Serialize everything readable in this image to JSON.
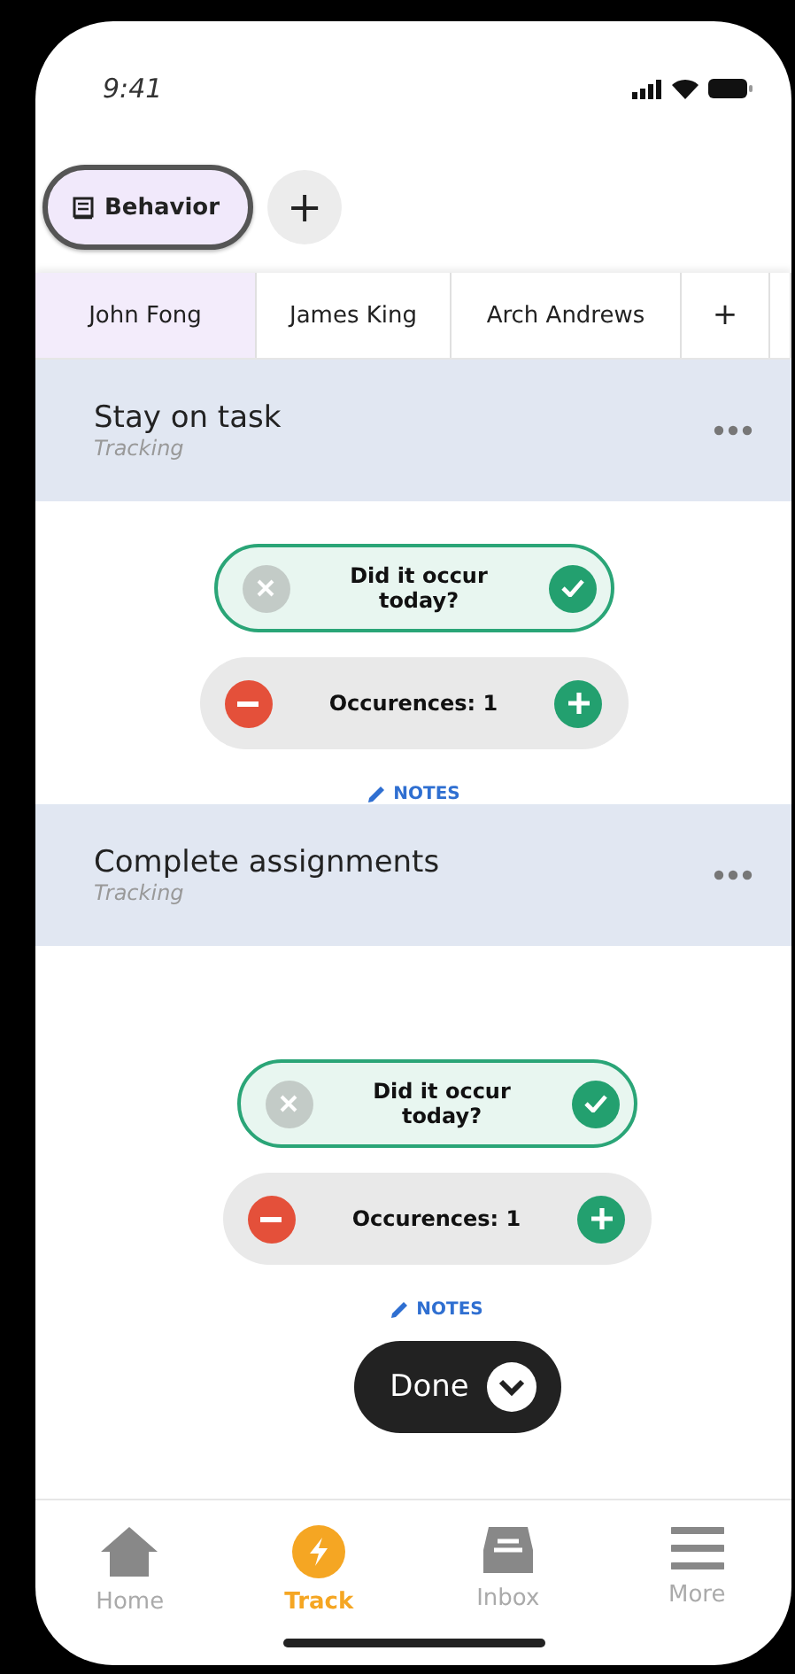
{
  "status_bar": {
    "time": "9:41"
  },
  "categories": [
    {
      "label": "Behavior",
      "selected": true
    }
  ],
  "add_category": "+",
  "students": [
    {
      "label": "John Fong",
      "selected": true
    },
    {
      "label": "James King",
      "selected": false
    },
    {
      "label": "Arch Andrews",
      "selected": false
    }
  ],
  "add_student": "+",
  "behaviors": [
    {
      "title": "Stay on task",
      "subtitle": "Tracking",
      "question": "Did it occur today?",
      "occurred": true,
      "occurrences": "Occurences: 1",
      "notes": "NOTES"
    },
    {
      "title": "Complete assignments",
      "subtitle": "Tracking",
      "question": "Did it occur today?",
      "occurred": true,
      "occurrences": "Occurences: 1",
      "notes": "NOTES"
    }
  ],
  "done_button": "Done",
  "tab_bar": [
    {
      "kind": "home",
      "label": "Home",
      "selected": false
    },
    {
      "kind": "track",
      "label": "Track",
      "selected": true
    },
    {
      "kind": "inbox",
      "label": "Inbox",
      "selected": false
    },
    {
      "kind": "more",
      "label": "More",
      "selected": false
    }
  ]
}
